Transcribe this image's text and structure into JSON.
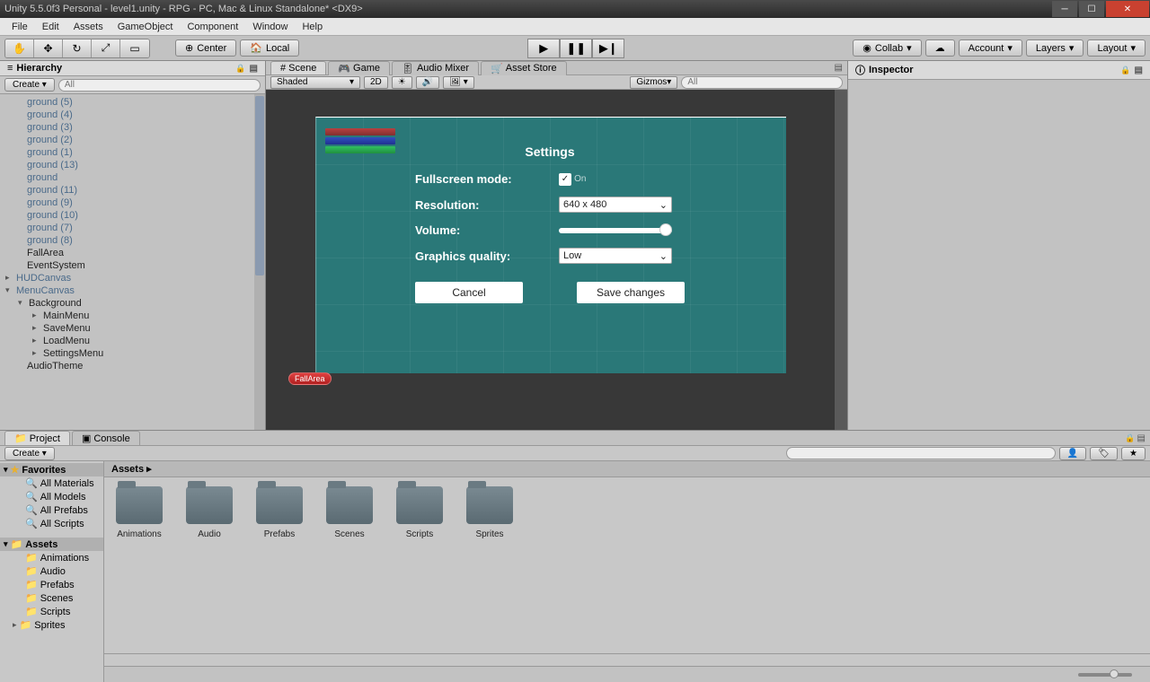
{
  "titlebar": "Unity 5.5.0f3 Personal - level1.unity - RPG - PC, Mac & Linux Standalone* <DX9>",
  "menubar": [
    "File",
    "Edit",
    "Assets",
    "GameObject",
    "Component",
    "Window",
    "Help"
  ],
  "toolbar": {
    "center": "Center",
    "local": "Local",
    "collab": "Collab",
    "account": "Account",
    "layers": "Layers",
    "layout": "Layout"
  },
  "hierarchy": {
    "title": "Hierarchy",
    "create": "Create",
    "search_placeholder": "All",
    "items": [
      {
        "label": "ground (5)",
        "blue": true
      },
      {
        "label": "ground (4)",
        "blue": true
      },
      {
        "label": "ground (3)",
        "blue": true
      },
      {
        "label": "ground (2)",
        "blue": true
      },
      {
        "label": "ground (1)",
        "blue": true
      },
      {
        "label": "ground (13)",
        "blue": true
      },
      {
        "label": "ground",
        "blue": true
      },
      {
        "label": "ground (11)",
        "blue": true
      },
      {
        "label": "ground (9)",
        "blue": true
      },
      {
        "label": "ground (10)",
        "blue": true
      },
      {
        "label": "ground (7)",
        "blue": true
      },
      {
        "label": "ground (8)",
        "blue": true
      },
      {
        "label": "FallArea",
        "blue": false
      },
      {
        "label": "EventSystem",
        "blue": false
      },
      {
        "label": "HUDCanvas",
        "blue": true,
        "arrow": true,
        "indent": 1
      },
      {
        "label": "MenuCanvas",
        "blue": true,
        "arrow": true,
        "open": true,
        "indent": 1
      },
      {
        "label": "Background",
        "blue": false,
        "arrow": true,
        "open": true,
        "indent": 2
      },
      {
        "label": "MainMenu",
        "blue": false,
        "arrow": true,
        "indent": 3
      },
      {
        "label": "SaveMenu",
        "blue": false,
        "arrow": true,
        "indent": 3
      },
      {
        "label": "LoadMenu",
        "blue": false,
        "arrow": true,
        "indent": 3
      },
      {
        "label": "SettingsMenu",
        "blue": false,
        "arrow": true,
        "indent": 3
      },
      {
        "label": "AudioTheme",
        "blue": false
      }
    ]
  },
  "scene_tabs": {
    "scene": "Scene",
    "game": "Game",
    "audio": "Audio Mixer",
    "store": "Asset Store"
  },
  "scene_toolbar": {
    "shaded": "Shaded",
    "twod": "2D",
    "gizmos": "Gizmos",
    "search_placeholder": "All"
  },
  "settings": {
    "title": "Settings",
    "fullscreen_label": "Fullscreen mode:",
    "fullscreen_on": "On",
    "resolution_label": "Resolution:",
    "resolution_value": "640 x 480",
    "volume_label": "Volume:",
    "quality_label": "Graphics quality:",
    "quality_value": "Low",
    "cancel": "Cancel",
    "save": "Save changes"
  },
  "fall_area_gizmo": "FallArea",
  "inspector": {
    "title": "Inspector"
  },
  "project": {
    "tab_project": "Project",
    "tab_console": "Console",
    "create": "Create",
    "favorites": "Favorites",
    "fav_items": [
      "All Materials",
      "All Models",
      "All Prefabs",
      "All Scripts"
    ],
    "assets": "Assets",
    "tree_folders": [
      "Animations",
      "Audio",
      "Prefabs",
      "Scenes",
      "Scripts",
      "Sprites"
    ],
    "breadcrumb": "Assets",
    "folders": [
      "Animations",
      "Audio",
      "Prefabs",
      "Scenes",
      "Scripts",
      "Sprites"
    ]
  }
}
